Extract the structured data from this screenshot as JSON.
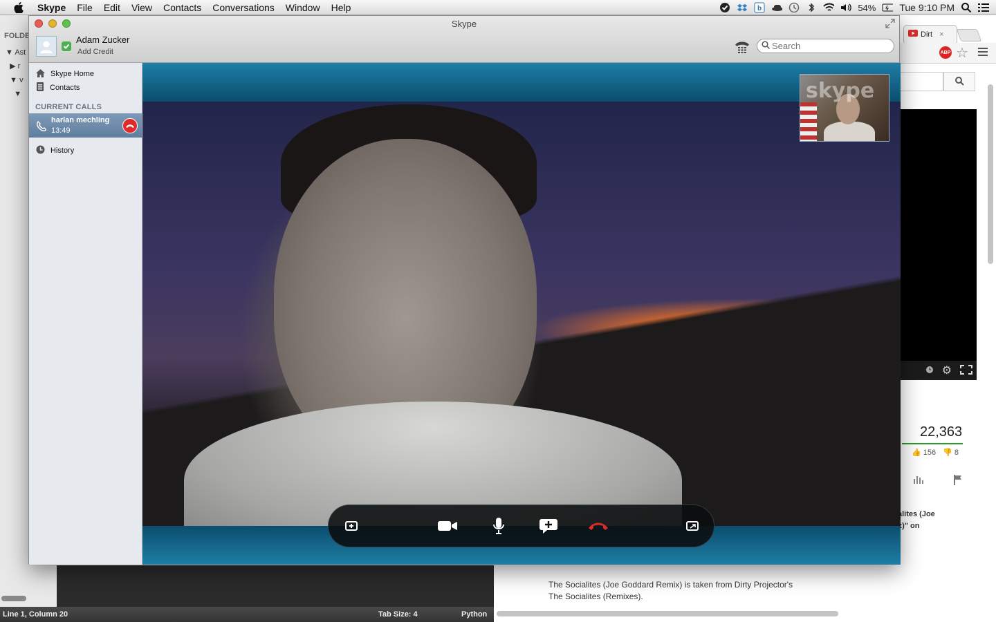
{
  "menubar": {
    "app_name": "Skype",
    "items": [
      "File",
      "Edit",
      "View",
      "Contacts",
      "Conversations",
      "Window",
      "Help"
    ],
    "battery": "54%",
    "clock": "Tue 9:10 PM"
  },
  "editor": {
    "folders_label": "FOLDE",
    "tree": [
      "Ast",
      "r",
      "v",
      ""
    ],
    "status_position": "Line 1, Column 20",
    "tab_size": "Tab Size: 4",
    "syntax": "Python"
  },
  "browser": {
    "tab_title": "Dirt",
    "adblock_label": "ABP",
    "view_count": "22,363",
    "likes": "156",
    "dislikes": "8",
    "desc_fragment_1": "alites (Joe",
    "desc_fragment_2": "x)\" on",
    "description_line_1": "The Socialites (Joe Goddard Remix) is taken from Dirty Projector's",
    "description_line_2": "The Socialites (Remixes)."
  },
  "skype": {
    "window_title": "Skype",
    "user_name": "Adam Zucker",
    "add_credit": "Add Credit",
    "search_placeholder": "Search",
    "nav": {
      "home": "Skype Home",
      "contacts": "Contacts",
      "history": "History"
    },
    "current_calls_header": "CURRENT CALLS",
    "call": {
      "name": "harlan mechling",
      "duration": "13:49"
    },
    "watermark": "skype",
    "colors": {
      "accent": "#1e7ea6",
      "hangup": "#e02a2a",
      "online": "#4caf50"
    }
  }
}
